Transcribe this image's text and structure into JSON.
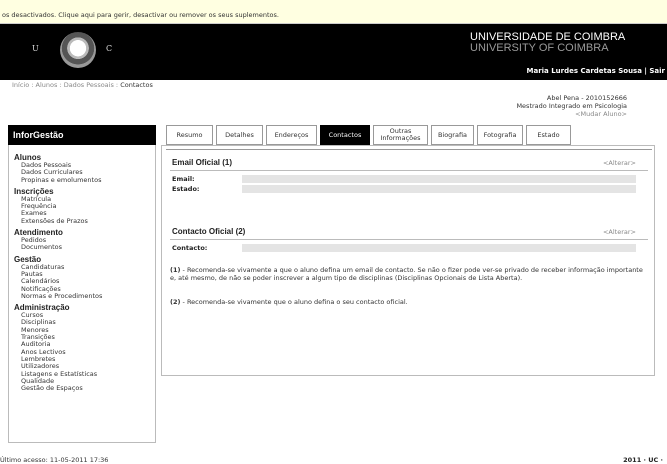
{
  "infobar": {
    "text": "os desactivados. Clique aqui para gerir, desactivar ou remover os seus suplementos."
  },
  "header": {
    "logo_letters": [
      "U",
      "C"
    ],
    "univ_pt": "UNIVERSIDADE DE COIMBRA",
    "univ_en": "UNIVERSITY OF COIMBRA",
    "user": "Maria Lurdes Cardetas Sousa | Sair"
  },
  "breadcrumb": {
    "path": "Início : Alunos : Dados Pessoais : ",
    "current": "Contactos"
  },
  "person": {
    "line1": "Abel Pena - 2010152666",
    "line2": "Mestrado Integrado em Psicologia",
    "line3": "<Mudar Aluno>"
  },
  "sidebar": {
    "title": "InforGestão",
    "sections": [
      {
        "label": "Alunos",
        "items": [
          "Dados Pessoais",
          "Dados Curriculares",
          "Propinas e emolumentos"
        ]
      },
      {
        "label": "Inscrições",
        "items": [
          "Matrícula",
          "Frequência",
          "Exames",
          "Extensões de Prazos"
        ]
      },
      {
        "label": "Atendimento",
        "items": [
          "Pedidos",
          "Documentos"
        ]
      },
      {
        "label": "Gestão",
        "items": [
          "Candidaturas",
          "Pautas",
          "Calendários",
          "Notificações",
          "Normas e Procedimentos"
        ]
      },
      {
        "label": "Administração",
        "items": [
          "Cursos",
          "Disciplinas",
          "Menores",
          "Transições",
          "Auditoria",
          "Anos Lectivos",
          "Lembretes",
          "Utilizadores",
          "Listagens e Estatísticas",
          "Qualidade",
          "Gestão de Espaços"
        ]
      }
    ]
  },
  "tabs": [
    {
      "label": "Resumo"
    },
    {
      "label": "Detalhes"
    },
    {
      "label": "Endereços"
    },
    {
      "label": "Contactos",
      "active": true
    },
    {
      "label": "Outras Informações"
    },
    {
      "label": "Biografia"
    },
    {
      "label": "Fotografia"
    },
    {
      "label": "Estado"
    }
  ],
  "main": {
    "email_section": {
      "title": "Email Oficial (1)",
      "alterar": "<Alterar>",
      "fields": [
        {
          "label": "Email:",
          "value": ""
        },
        {
          "label": "Estado:",
          "value": ""
        }
      ]
    },
    "contact_section": {
      "title": "Contacto Oficial (2)",
      "alterar": "<Alterar>",
      "fields": [
        {
          "label": "Contacto:",
          "value": ""
        }
      ]
    },
    "note1": {
      "marker": "(1)",
      "text": " - Recomenda-se vivamente a que o aluno defina um email de contacto. Se não o fizer pode ver-se privado de receber informação importante e, até mesmo, de não se poder inscrever a algum tipo de disciplinas (Disciplinas Opcionais de Lista Aberta)."
    },
    "note2": {
      "marker": "(2)",
      "text": " - Recomenda-se vivamente que o aluno defina o seu contacto oficial."
    }
  },
  "footer": {
    "last_access": "Último acesso: 11-05-2011 17:36",
    "copyright": "2011 · UC ·"
  }
}
